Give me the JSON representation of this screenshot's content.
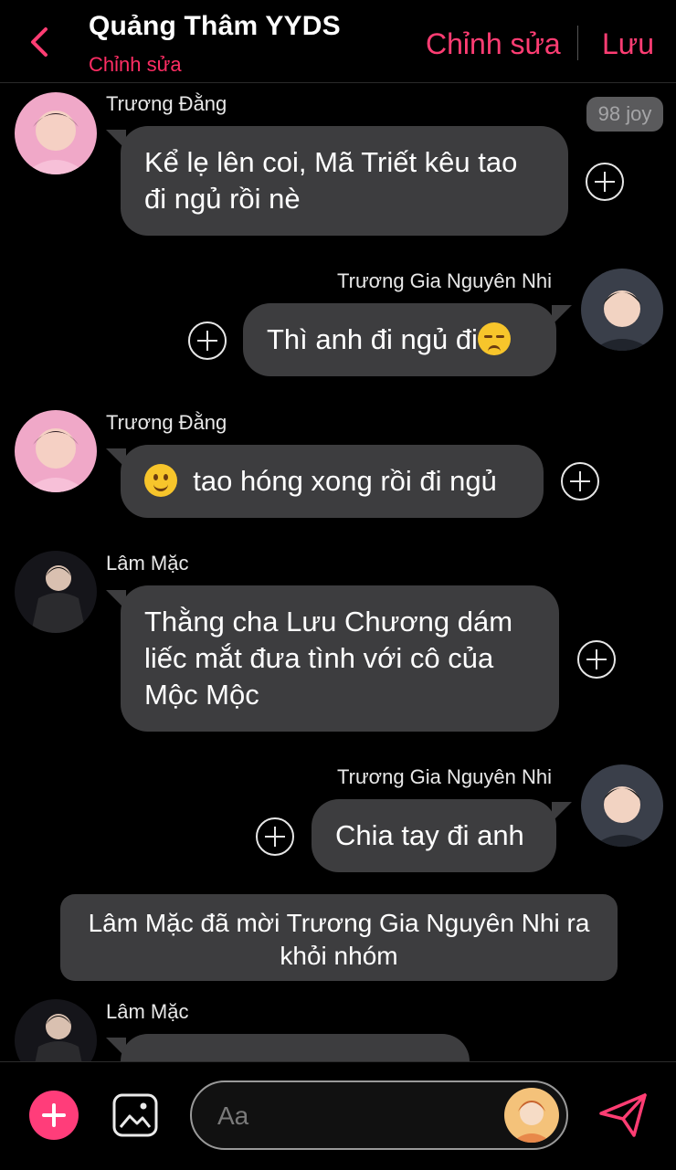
{
  "header": {
    "title": "Quảng Thâm YYDS",
    "subtitle": "Chỉnh sửa",
    "edit_label": "Chỉnh sửa",
    "save_label": "Lưu"
  },
  "joy_badge": "98 joy",
  "messages": [
    {
      "sender": "Trương Đằng",
      "text": "Kể lẹ lên coi, Mã Triết kêu tao đi ngủ rồi nè",
      "side": "left"
    },
    {
      "sender": "Trương Gia Nguyên Nhi",
      "text": "Thì anh đi ngủ đi",
      "emoji": "unamused-face",
      "side": "right"
    },
    {
      "sender": "Trương Đằng",
      "text": "tao hóng xong rồi đi ngủ",
      "emoji": "slightly-smiling-face",
      "side": "left"
    },
    {
      "sender": "Lâm Mặc",
      "text": "Thằng cha Lưu Chương dám liếc mắt đưa tình với cô của Mộc Mộc",
      "side": "left"
    },
    {
      "sender": "Trương Gia Nguyên Nhi",
      "text": "Chia tay đi anh",
      "side": "right"
    },
    {
      "sender": "Lâm Mặc",
      "text": "",
      "side": "left"
    }
  ],
  "system_message": "Lâm Mặc đã mời Trương Gia Nguyên Nhi ra khỏi nhóm",
  "composer": {
    "placeholder": "Aa"
  },
  "colors": {
    "accent": "#ff3d73",
    "bubble": "#3d3d3f",
    "background": "#000000"
  }
}
